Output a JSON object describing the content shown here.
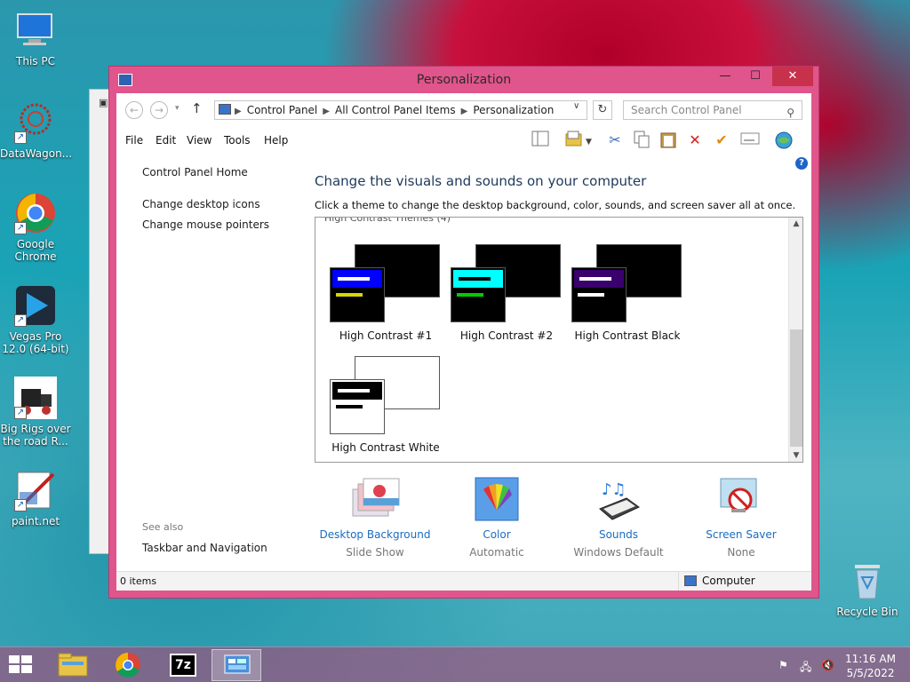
{
  "desktop": {
    "icons": [
      {
        "label": "This PC"
      },
      {
        "label": "DataWagon..."
      },
      {
        "label": "Google Chrome"
      },
      {
        "label": "Vegas Pro 12.0 (64-bit)"
      },
      {
        "label": "Big Rigs over the road R..."
      },
      {
        "label": "paint.net"
      },
      {
        "label": "Recycle Bin"
      }
    ]
  },
  "window": {
    "title": "Personalization",
    "breadcrumb": [
      "Control Panel",
      "All Control Panel Items",
      "Personalization"
    ],
    "search_placeholder": "Search Control Panel",
    "menu": [
      "File",
      "Edit",
      "View",
      "Tools",
      "Help"
    ]
  },
  "left_pane": {
    "home": "Control Panel Home",
    "links": [
      "Change desktop icons",
      "Change mouse pointers"
    ],
    "see_also_label": "See also",
    "see_also_links": [
      "Taskbar and Navigation"
    ]
  },
  "main": {
    "heading": "Change the visuals and sounds on your computer",
    "description": "Click a theme to change the desktop background, color, sounds, and screen saver all at once.",
    "group_label": "High Contrast Themes (4)",
    "themes": [
      {
        "name": "High Contrast #1",
        "bar_color": "#0000ff",
        "line_color": "#d7d700",
        "bg": "#000000",
        "text": "#ffffff"
      },
      {
        "name": "High Contrast #2",
        "bar_color": "#00ffff",
        "line_color": "#00cc00",
        "bg": "#000000",
        "text": "#000000"
      },
      {
        "name": "High Contrast Black",
        "bar_color": "#3a006e",
        "line_color": "#ffffff",
        "bg": "#000000",
        "text": "#ffffff"
      },
      {
        "name": "High Contrast White",
        "bar_color": "#000000",
        "line_color": "#000000",
        "bg": "#ffffff",
        "text": "#ffffff"
      }
    ],
    "options": [
      {
        "title": "Desktop Background",
        "sub": "Slide Show"
      },
      {
        "title": "Color",
        "sub": "Automatic"
      },
      {
        "title": "Sounds",
        "sub": "Windows Default"
      },
      {
        "title": "Screen Saver",
        "sub": "None"
      }
    ]
  },
  "statusbar": {
    "items": "0 items",
    "location": "Computer"
  },
  "taskbar": {
    "time": "11:16 AM",
    "date": "5/5/2022",
    "app_label_7z": "7z"
  },
  "colors": {
    "window_frame": "#e0558b",
    "close_button": "#c7314b",
    "link": "#1a6cc0",
    "heading": "#1e395b"
  }
}
